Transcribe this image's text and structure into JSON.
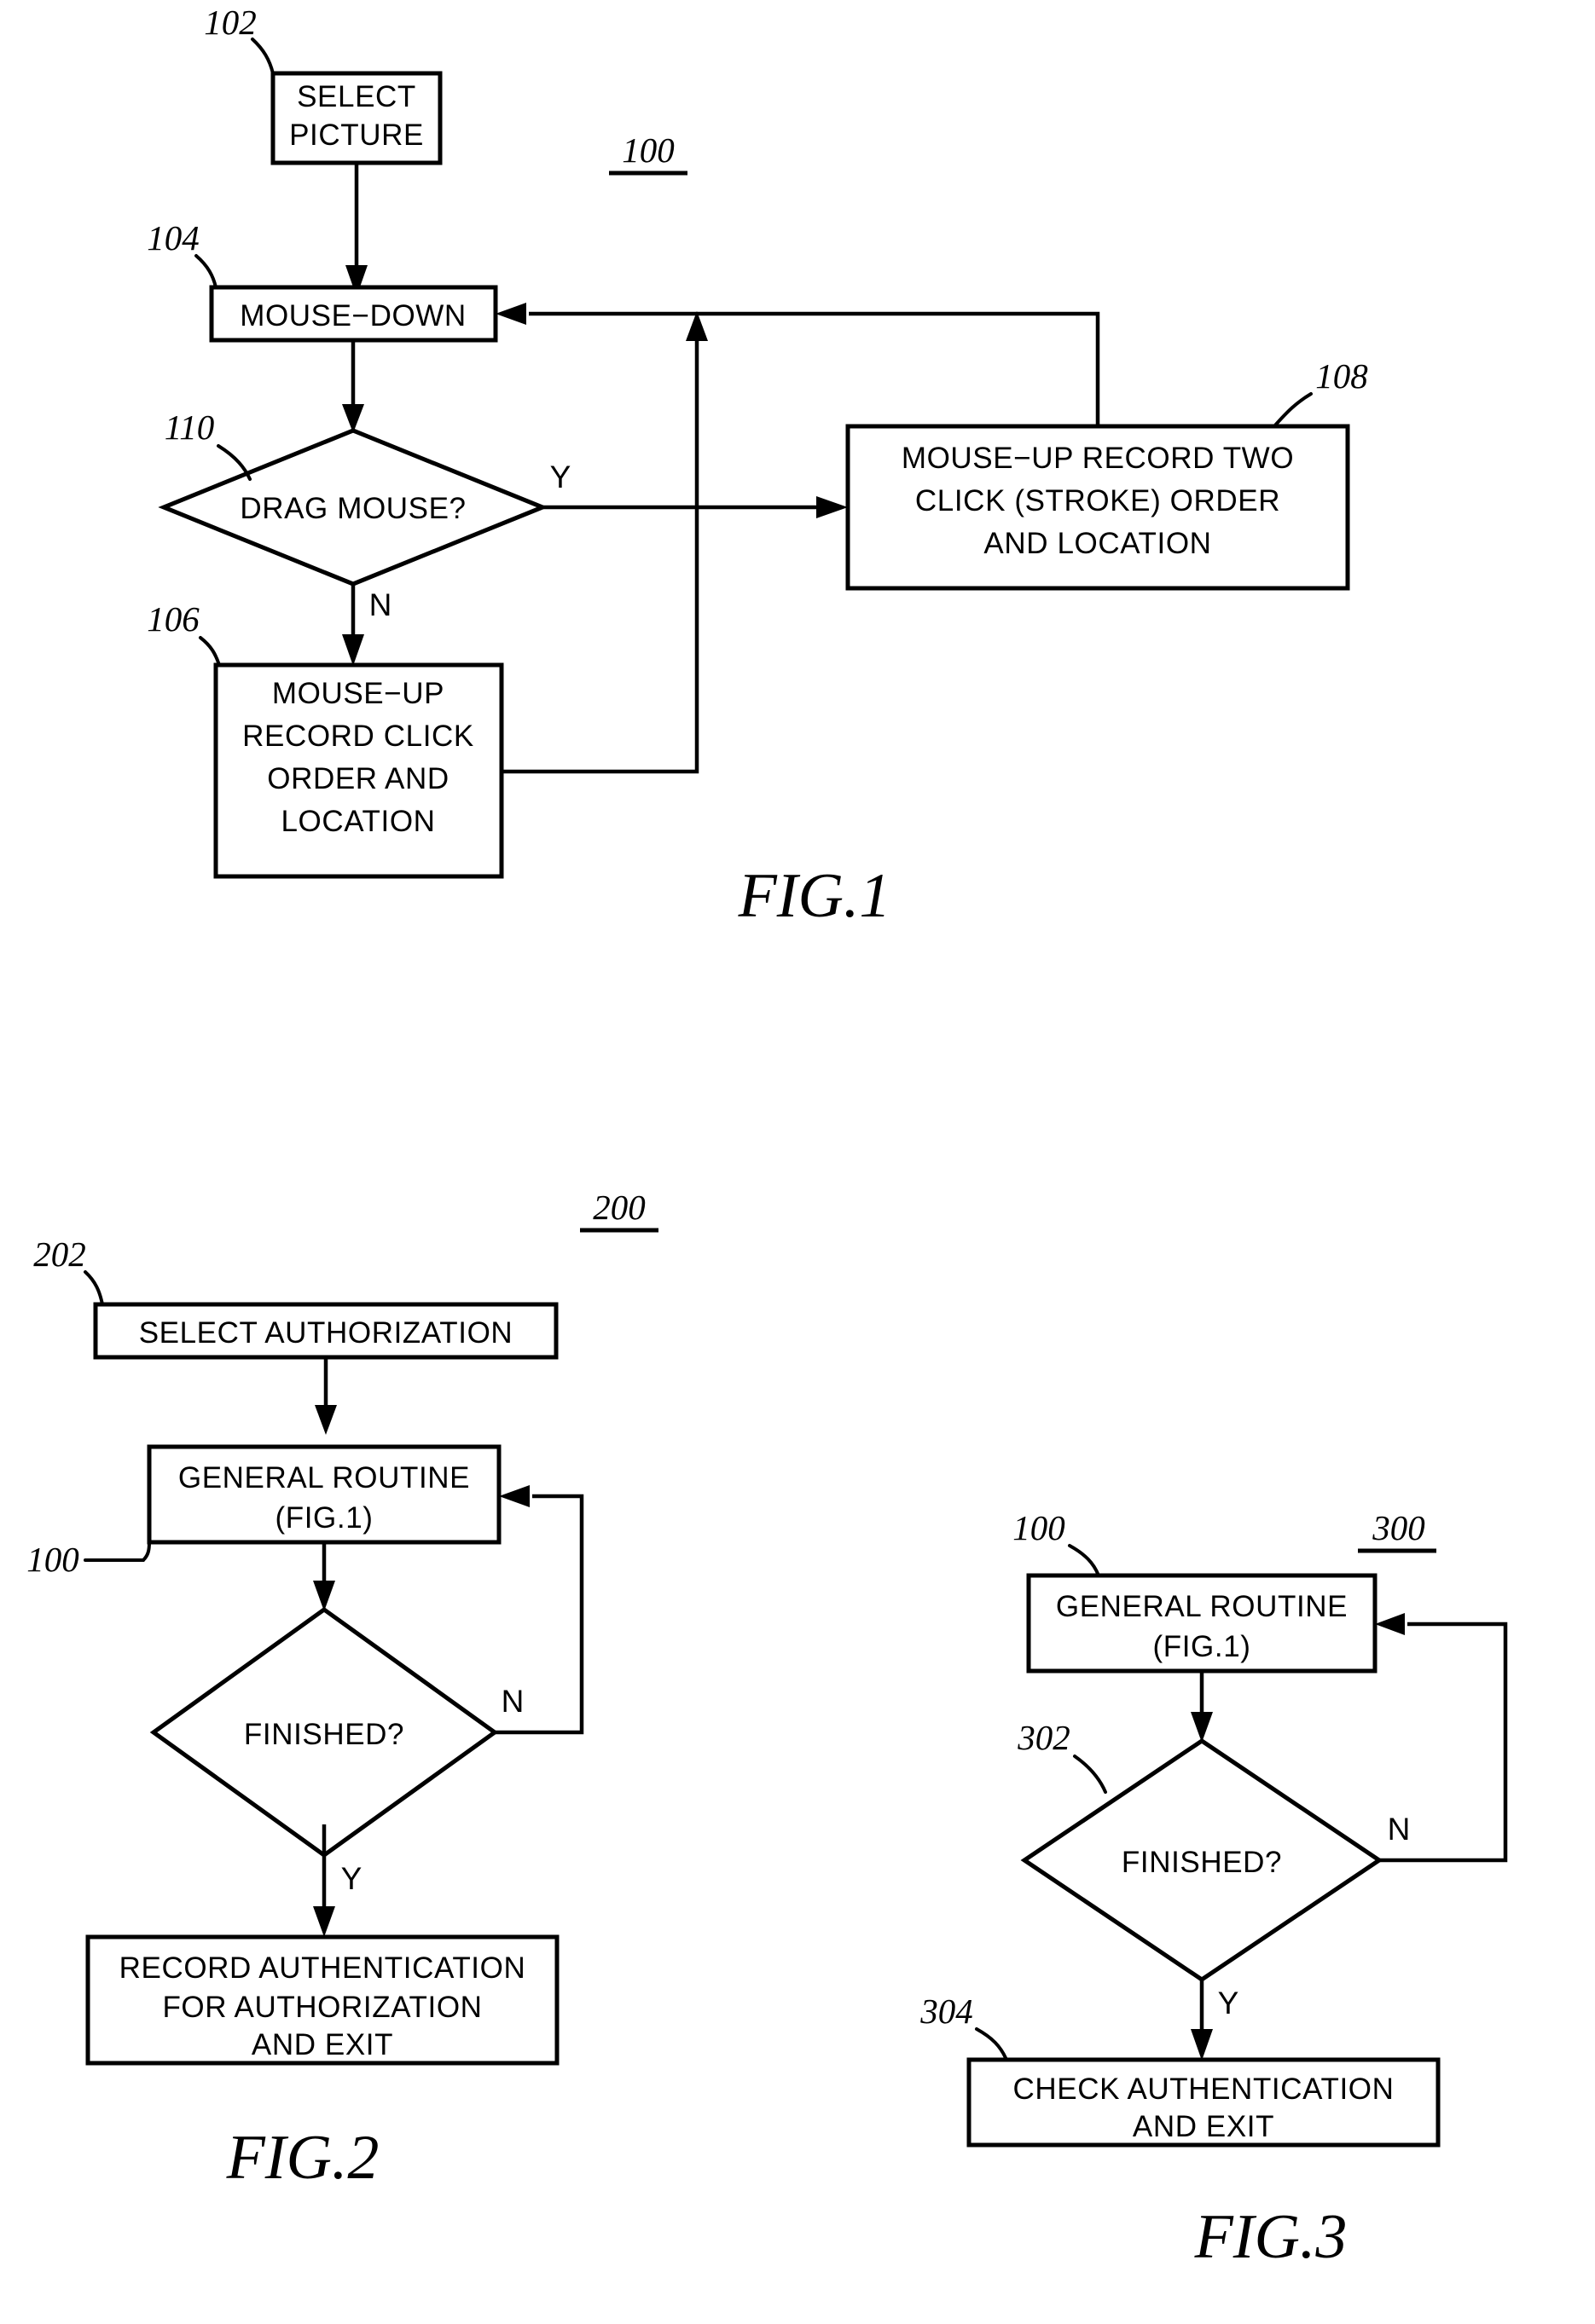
{
  "document": {
    "type": "patent-figure-sheet",
    "figures": [
      {
        "id": "fig1",
        "caption": "FIG.1",
        "ref": "100",
        "nodes": [
          {
            "ref": "102",
            "shape": "process",
            "lines": [
              "SELECT",
              "PICTURE"
            ]
          },
          {
            "ref": "104",
            "shape": "process",
            "lines": [
              "MOUSE−DOWN"
            ]
          },
          {
            "ref": "110",
            "shape": "decision",
            "lines": [
              "DRAG  MOUSE?"
            ]
          },
          {
            "ref": "108",
            "shape": "process",
            "lines": [
              "MOUSE−UP  RECORD  TWO",
              "CLICK  (STROKE)  ORDER",
              "AND  LOCATION"
            ]
          },
          {
            "ref": "106",
            "shape": "process",
            "lines": [
              "MOUSE−UP",
              "RECORD  CLICK",
              "ORDER  AND",
              "LOCATION"
            ]
          }
        ],
        "edge_labels": [
          {
            "label": "Y",
            "from": "110",
            "to": "108"
          },
          {
            "label": "N",
            "from": "110",
            "to": "106"
          }
        ]
      },
      {
        "id": "fig2",
        "caption": "FIG.2",
        "ref": "200",
        "nodes": [
          {
            "ref": "202",
            "shape": "process",
            "lines": [
              "SELECT  AUTHORIZATION"
            ]
          },
          {
            "ref": "100",
            "shape": "process",
            "lines": [
              "GENERAL  ROUTINE",
              "(FIG.1)"
            ]
          },
          {
            "ref": "",
            "shape": "decision",
            "lines": [
              "FINISHED?"
            ]
          },
          {
            "ref": "",
            "shape": "process",
            "lines": [
              "RECORD  AUTHENTICATION",
              "FOR  AUTHORIZATION",
              "AND  EXIT"
            ]
          }
        ],
        "edge_labels": [
          {
            "label": "N",
            "from": "FINISHED?",
            "to": "100"
          },
          {
            "label": "Y",
            "from": "FINISHED?",
            "to": "RECORD AUTHENTICATION"
          }
        ]
      },
      {
        "id": "fig3",
        "caption": "FIG.3",
        "ref": "300",
        "nodes": [
          {
            "ref": "100",
            "shape": "process",
            "lines": [
              "GENERAL  ROUTINE",
              "(FIG.1)"
            ]
          },
          {
            "ref": "302",
            "shape": "decision",
            "lines": [
              "FINISHED?"
            ]
          },
          {
            "ref": "304",
            "shape": "process",
            "lines": [
              "CHECK  AUTHENTICATION",
              "AND  EXIT"
            ]
          }
        ],
        "edge_labels": [
          {
            "label": "N",
            "from": "302",
            "to": "100"
          },
          {
            "label": "Y",
            "from": "302",
            "to": "304"
          }
        ]
      }
    ]
  },
  "fig1": {
    "ref": "100",
    "caption": "FIG.1",
    "n102_ref": "102",
    "n102_l1": "SELECT",
    "n102_l2": "PICTURE",
    "n104_ref": "104",
    "n104_l1": "MOUSE−DOWN",
    "n110_ref": "110",
    "n110_l1": "DRAG  MOUSE?",
    "n110_yes": "Y",
    "n110_no": "N",
    "n108_ref": "108",
    "n108_l1": "MOUSE−UP  RECORD  TWO",
    "n108_l2": "CLICK  (STROKE)  ORDER",
    "n108_l3": "AND  LOCATION",
    "n106_ref": "106",
    "n106_l1": "MOUSE−UP",
    "n106_l2": "RECORD  CLICK",
    "n106_l3": "ORDER  AND",
    "n106_l4": "LOCATION"
  },
  "fig2": {
    "ref": "200",
    "caption": "FIG.2",
    "n202_ref": "202",
    "n202_l1": "SELECT  AUTHORIZATION",
    "n100_ref": "100",
    "n100_l1": "GENERAL  ROUTINE",
    "n100_l2": "(FIG.1)",
    "nfin_l1": "FINISHED?",
    "nfin_no": "N",
    "nfin_yes": "Y",
    "nrec_l1": "RECORD  AUTHENTICATION",
    "nrec_l2": "FOR  AUTHORIZATION",
    "nrec_l3": "AND  EXIT"
  },
  "fig3": {
    "ref": "300",
    "caption": "FIG.3",
    "n100_ref": "100",
    "n100_l1": "GENERAL  ROUTINE",
    "n100_l2": "(FIG.1)",
    "n302_ref": "302",
    "n302_l1": "FINISHED?",
    "n302_no": "N",
    "n302_yes": "Y",
    "n304_ref": "304",
    "n304_l1": "CHECK  AUTHENTICATION",
    "n304_l2": "AND  EXIT"
  },
  "colors": {
    "ink": "#000000",
    "paper": "#ffffff"
  }
}
